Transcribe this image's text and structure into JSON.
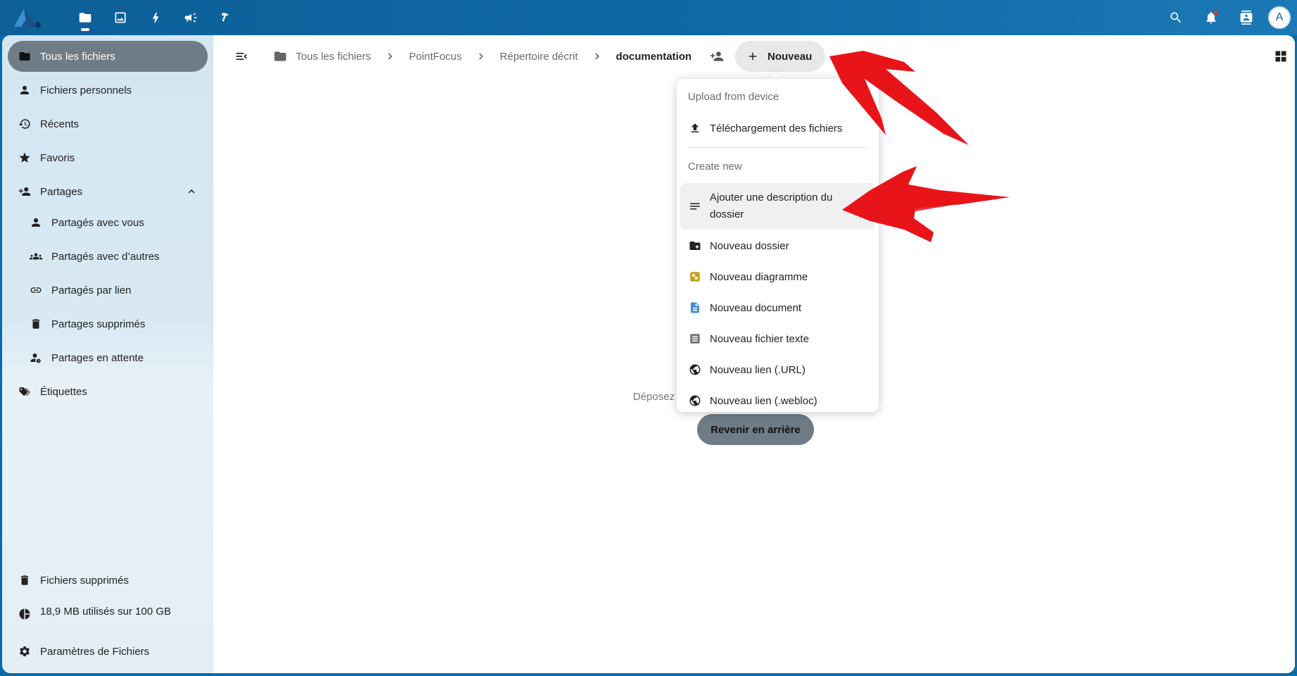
{
  "header": {
    "apps": [
      {
        "name": "files",
        "active": true
      },
      {
        "name": "photos",
        "active": false
      },
      {
        "name": "activity",
        "active": false
      },
      {
        "name": "announcements",
        "active": false
      },
      {
        "name": "flow",
        "active": false
      }
    ],
    "avatar_initial": "A"
  },
  "sidebar": {
    "items": [
      {
        "label": "Tous les fichiers",
        "icon": "folder-icon",
        "active": true
      },
      {
        "label": "Fichiers personnels",
        "icon": "person-icon"
      },
      {
        "label": "Récents",
        "icon": "history-icon"
      },
      {
        "label": "Favoris",
        "icon": "star-icon"
      },
      {
        "label": "Partages",
        "icon": "share-person-icon",
        "expanded": true
      },
      {
        "label": "Partagés avec vous",
        "icon": "person-icon",
        "sub": true
      },
      {
        "label": "Partagés avec d’autres",
        "icon": "group-icon",
        "sub": true
      },
      {
        "label": "Partagés par lien",
        "icon": "link-icon",
        "sub": true
      },
      {
        "label": "Partages supprimés",
        "icon": "trash-icon",
        "sub": true
      },
      {
        "label": "Partages en attente",
        "icon": "pending-person-icon",
        "sub": true
      },
      {
        "label": "Étiquettes",
        "icon": "tags-icon"
      }
    ],
    "footer": {
      "deleted_files": "Fichiers supprimés",
      "quota": "18,9 MB utilisés sur 100 GB",
      "settings": "Paramètres de Fichiers"
    }
  },
  "breadcrumbs": [
    "Tous les fichiers",
    "PointFocus",
    "Répertoire décrit",
    "documentation"
  ],
  "toolbar": {
    "new_label": "Nouveau"
  },
  "empty": {
    "text": "Déposez",
    "back_label": "Revenir en arrière"
  },
  "menu": {
    "upload_caption": "Upload from device",
    "upload_item": "Téléchargement des fichiers",
    "create_caption": "Create new",
    "items": [
      "Ajouter une description du dossier",
      "Nouveau dossier",
      "Nouveau diagramme",
      "Nouveau document",
      "Nouveau fichier texte",
      "Nouveau lien (.URL)",
      "Nouveau lien (.webloc)"
    ]
  },
  "colors": {
    "header": "#0f6aa6",
    "active_nav": "#6f7b85",
    "annotation": "#e8141a",
    "diagram_icon": "#c9a017",
    "document_icon": "#3d8fd6"
  }
}
